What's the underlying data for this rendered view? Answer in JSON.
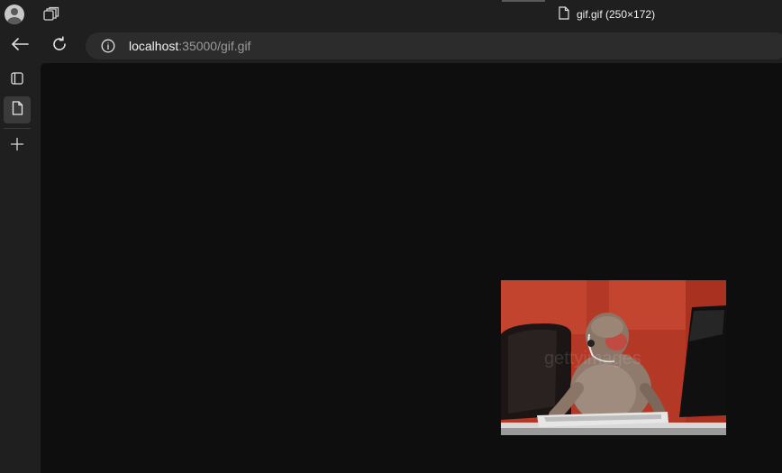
{
  "tab": {
    "title": "gif.gif (250×172)",
    "icon": "document-icon"
  },
  "address": {
    "host": "localhost",
    "path": ":35000/gif.gif"
  },
  "toolbar": {
    "back_icon": "back-arrow-icon",
    "reload_icon": "reload-icon",
    "info_icon": "info-icon"
  },
  "sidebar": {
    "items": [
      {
        "icon": "tab-actions-icon"
      },
      {
        "icon": "document-icon",
        "active": true
      },
      {
        "icon": "plus-icon"
      }
    ]
  },
  "image": {
    "description": "office monkey typing at computer",
    "watermark": "gettyimages"
  },
  "colors": {
    "chrome": "#1f1f1f",
    "viewport": "#0e0e0e",
    "address_bar": "#2c2c2c"
  }
}
